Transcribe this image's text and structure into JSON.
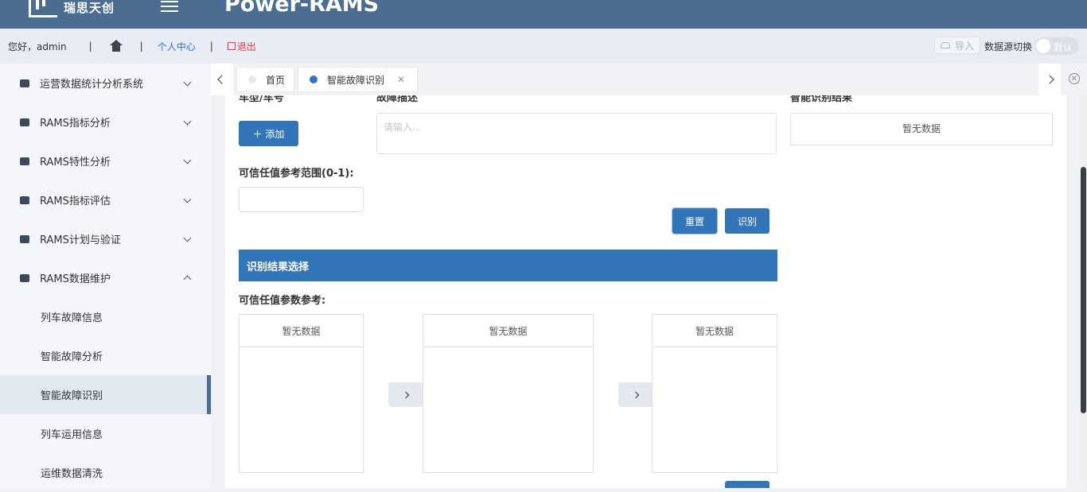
{
  "header": {
    "logo_text": "瑞思天创",
    "app_title": "Power-RAMS"
  },
  "userbar": {
    "greeting": "您好，admin",
    "separator": "|",
    "personal_center": "个人中心",
    "logout": "退出",
    "import_label": "导入",
    "datasource_label": "数据源切换",
    "switch_label": "默认"
  },
  "sidebar": {
    "items": [
      {
        "label": "运营数据统计分析系统",
        "icon": "train-icon"
      },
      {
        "label": "RAMS指标分析",
        "icon": "folder-icon"
      },
      {
        "label": "RAMS特性分析",
        "icon": "car-icon"
      },
      {
        "label": "RAMS指标评估",
        "icon": "book-icon"
      },
      {
        "label": "RAMS计划与验证",
        "icon": "person-icon"
      },
      {
        "label": "RAMS数据维护",
        "icon": "card-icon"
      }
    ],
    "subitems": [
      "列车故障信息",
      "智能故障分析",
      "智能故障识别",
      "列车运用信息",
      "运维数据清洗"
    ]
  },
  "tabs": [
    {
      "label": "首页",
      "dot_color": "#e4e7ed"
    },
    {
      "label": "智能故障识别",
      "dot_color": "#3375b9"
    }
  ],
  "form": {
    "model_label": "车型/车号",
    "add_button": "＋ 添加",
    "desc_label": "故障描述",
    "desc_placeholder": "请输入...",
    "result_label": "智能识别结果",
    "no_data": "暂无数据",
    "trust_range_label": "可信任值参考范围(0-1):",
    "reset_button": "重置",
    "identify_button": "识别",
    "section_title": "识别结果选择",
    "trust_param_label": "可信任值参数参考:"
  },
  "colors": {
    "header_bg": "#4a6d91",
    "primary": "#3375b9",
    "danger": "#e4393c",
    "link": "#2f6fdc"
  }
}
